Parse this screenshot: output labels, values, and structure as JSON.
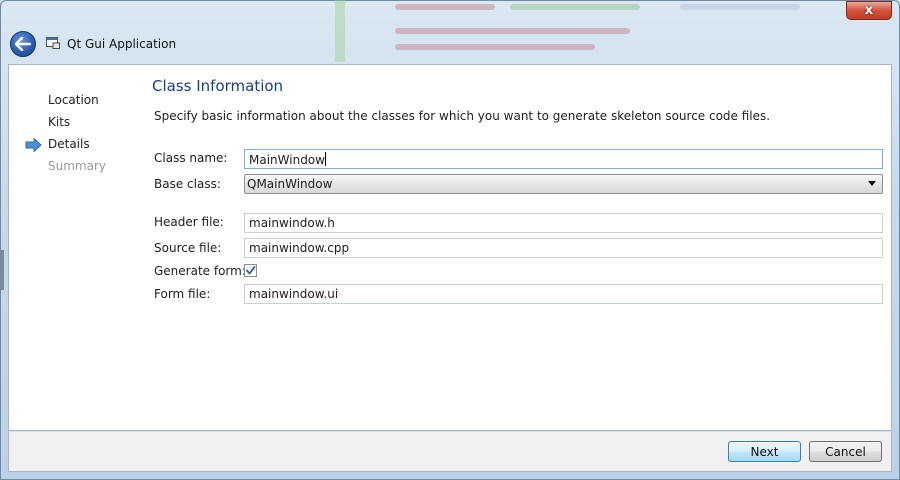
{
  "window": {
    "title": "Qt Gui Application",
    "close_glyph": "x"
  },
  "nav": {
    "items": [
      {
        "label": "Location",
        "state": "done"
      },
      {
        "label": "Kits",
        "state": "done"
      },
      {
        "label": "Details",
        "state": "current"
      },
      {
        "label": "Summary",
        "state": "pending"
      }
    ]
  },
  "page": {
    "heading": "Class Information",
    "description": "Specify basic information about the classes for which you want to generate skeleton source code files."
  },
  "form": {
    "class_name": {
      "label": "Class name:",
      "value": "MainWindow"
    },
    "base_class": {
      "label": "Base class:",
      "value": "QMainWindow"
    },
    "header_file": {
      "label": "Header file:",
      "value": "mainwindow.h"
    },
    "source_file": {
      "label": "Source file:",
      "value": "mainwindow.cpp"
    },
    "generate_form": {
      "label": "Generate form:",
      "checked": true
    },
    "form_file": {
      "label": "Form file:",
      "value": "mainwindow.ui"
    }
  },
  "buttons": {
    "next": "Next",
    "cancel": "Cancel"
  },
  "colors": {
    "heading": "#1a3e8c",
    "accent": "#3c7fb1",
    "nav_arrow": "#4f8fd6",
    "disabled_text": "#9a9a9a"
  },
  "icons": {
    "back": "back-arrow-icon",
    "app": "app-window-icon",
    "nav_current": "current-step-arrow-icon",
    "check": "checkmark-icon",
    "dropdown": "chevron-down-icon",
    "close": "close-icon"
  }
}
